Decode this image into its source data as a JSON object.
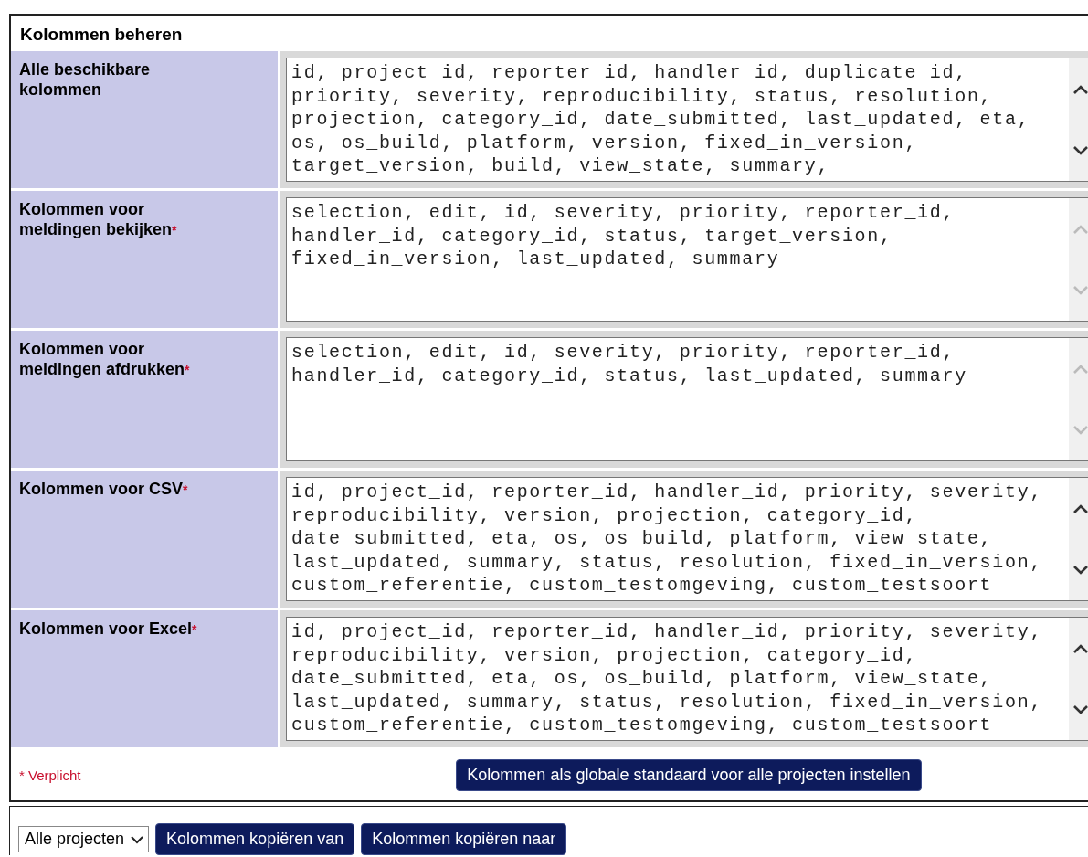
{
  "panel": {
    "title": "Kolommen beheren",
    "rows": [
      {
        "label": "Alle beschikbare kolommen",
        "scrollable": true,
        "lines": [
          "id, project_id, reporter_id, handler_id, duplicate_id,",
          "priority, severity, reproducibility, status, resolution,",
          "projection, category_id, date_submitted, last_updated, eta,",
          "os, os_build, platform, version, fixed_in_version,",
          "target_version, build, view_state, summary,"
        ]
      },
      {
        "label": "Kolommen voor meldingen bekijken",
        "required_mark": "*",
        "scrollable": false,
        "lines": [
          "selection, edit, id, severity, priority, reporter_id,",
          "handler_id, category_id, status, target_version,",
          "fixed_in_version, last_updated, summary"
        ]
      },
      {
        "label": "Kolommen voor meldingen afdrukken",
        "required_mark": "*",
        "scrollable": false,
        "lines": [
          "selection, edit, id, severity, priority, reporter_id,",
          "handler_id, category_id, status, last_updated, summary"
        ]
      },
      {
        "label": "Kolommen voor CSV",
        "required_mark": "*",
        "scrollable": true,
        "lines": [
          "id, project_id, reporter_id, handler_id, priority, severity,",
          "reproducibility, version, projection, category_id,",
          "date_submitted, eta, os, os_build, platform, view_state,",
          "last_updated, summary, status, resolution, fixed_in_version,",
          "custom_referentie, custom_testomgeving, custom_testsoort"
        ]
      },
      {
        "label": "Kolommen voor Excel",
        "required_mark": "*",
        "scrollable": true,
        "lines": [
          "id, project_id, reporter_id, handler_id, priority, severity,",
          "reproducibility, version, projection, category_id,",
          "date_submitted, eta, os, os_build, platform, view_state,",
          "last_updated, summary, status, resolution, fixed_in_version,",
          "custom_referentie, custom_testomgeving, custom_testsoort"
        ]
      }
    ],
    "footnote": "* Verplicht",
    "submit_button": "Kolommen als globale standaard voor alle projecten instellen"
  },
  "copy_bar": {
    "project_select": "Alle projecten",
    "buttons": [
      "Kolommen kopiëren van",
      "Kolommen kopiëren naar"
    ]
  }
}
